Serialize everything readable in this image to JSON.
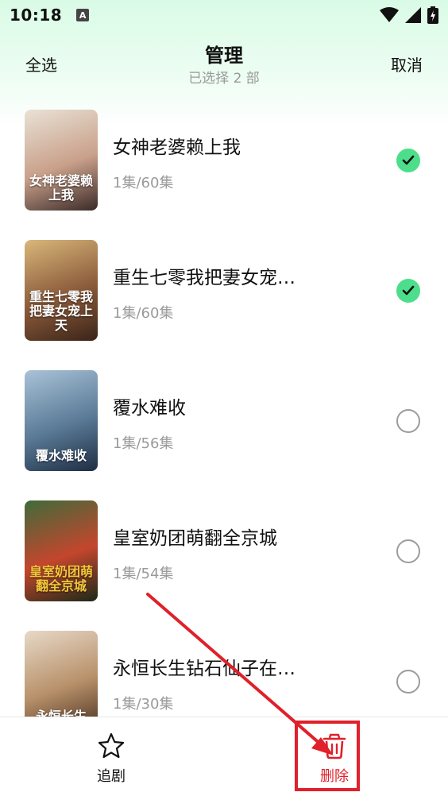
{
  "status": {
    "time": "10:18",
    "notification_icon_letter": "A",
    "icons": [
      "wifi-icon",
      "signal-icon",
      "battery-icon"
    ]
  },
  "header": {
    "select_all": "全选",
    "title": "管理",
    "subtitle": "已选择 2 部",
    "cancel": "取消"
  },
  "items": [
    {
      "title": "女神老婆赖上我",
      "progress": "1集/60集",
      "checked": true,
      "poster_text": "女神老婆赖上我",
      "poster_colors": [
        "#e9e2d6",
        "#c9a08a",
        "#3a2a28"
      ]
    },
    {
      "title": "重生七零我把妻女宠…",
      "progress": "1集/60集",
      "checked": true,
      "poster_text": "重生七零我把妻女宠上天",
      "poster_colors": [
        "#d9b77a",
        "#8a5a3a",
        "#3b2418"
      ]
    },
    {
      "title": "覆水难收",
      "progress": "1集/56集",
      "checked": false,
      "poster_text": "覆水难收",
      "poster_colors": [
        "#a9c3d8",
        "#5a7a96",
        "#1e2e44"
      ]
    },
    {
      "title": "皇室奶团萌翻全京城",
      "progress": "1集/54集",
      "checked": false,
      "poster_text": "皇室奶团萌翻全京城",
      "poster_colors": [
        "#3f6b3a",
        "#c4462d",
        "#1b2a18"
      ]
    },
    {
      "title": "永恒长生钻石仙子在…",
      "progress": "1集/30集",
      "checked": false,
      "poster_text": "永恒长生",
      "poster_colors": [
        "#e7d9c8",
        "#b8916a",
        "#4a3020"
      ]
    }
  ],
  "bottom": {
    "follow_label": "追剧",
    "delete_label": "删除"
  },
  "colors": {
    "accent_green": "#4cde8a",
    "delete_red": "#e0202a",
    "annotation_red": "#e0202a"
  }
}
